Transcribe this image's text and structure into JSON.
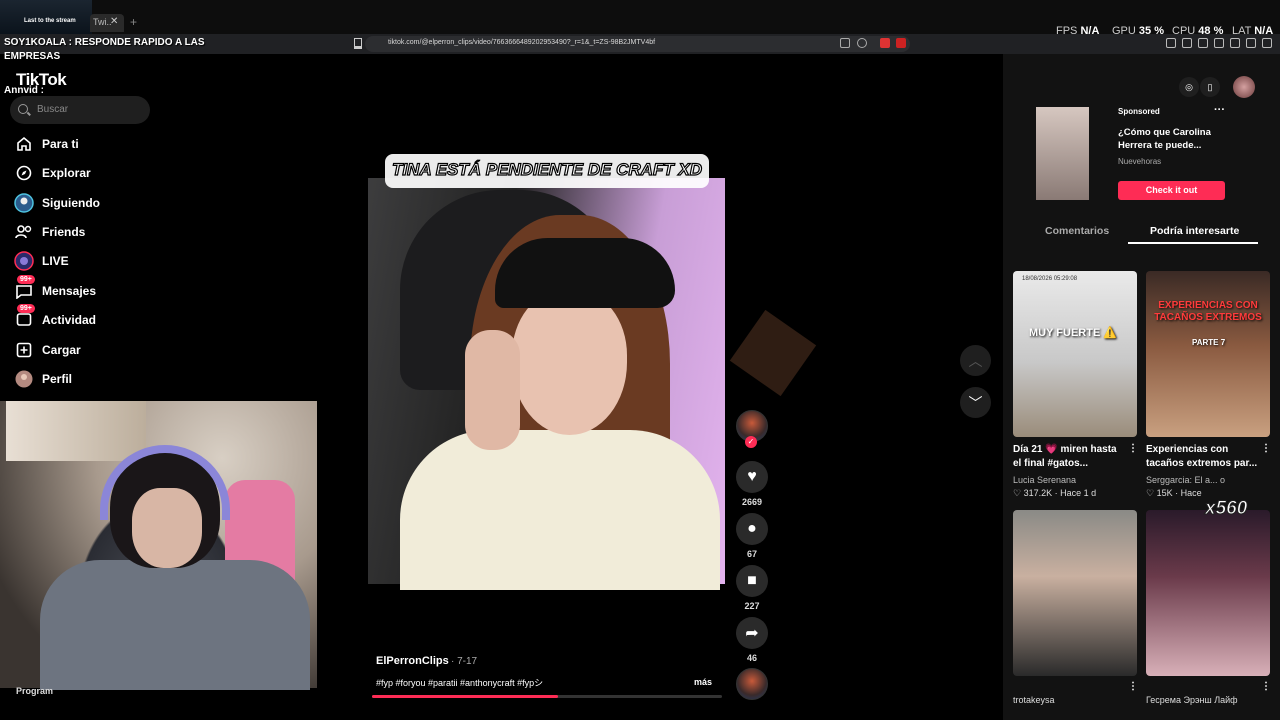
{
  "browser": {
    "tab_label": "Twi..",
    "url": "tiktok.com/@elperron_clips/video/7663666489202953490?_r=1&_t=ZS-98B2JMTV4bf",
    "perf": [
      {
        "key": "FPS",
        "value": "N/A"
      },
      {
        "key": "GPU",
        "value": "35 %"
      },
      {
        "key": "CPU",
        "value": "48 %"
      },
      {
        "key": "LAT",
        "value": "N/A"
      }
    ]
  },
  "stream": {
    "overlay_text": "Last to the stream",
    "chat_1": "SOY1KOALA : RESPONDE RAPIDO A LAS",
    "chat_1b": "EMPRESAS",
    "chat_2": "Annvid :",
    "program_label": "Program"
  },
  "sidebar": {
    "logo": "TikTok",
    "search_placeholder": "Buscar",
    "items": [
      {
        "label": "Para ti",
        "icon": "home-icon"
      },
      {
        "label": "Explorar",
        "icon": "compass-icon"
      },
      {
        "label": "Siguiendo",
        "icon": "following-icon"
      },
      {
        "label": "Friends",
        "icon": "friends-icon"
      },
      {
        "label": "LIVE",
        "icon": "live-icon"
      },
      {
        "label": "Mensajes",
        "icon": "messages-icon",
        "badge": "99+"
      },
      {
        "label": "Actividad",
        "icon": "activity-icon",
        "badge": "99+"
      },
      {
        "label": "Cargar",
        "icon": "upload-icon"
      },
      {
        "label": "Perfil",
        "icon": "profile-avatar"
      }
    ]
  },
  "video": {
    "caption": "TINA ESTÁ PENDIENTE DE CRAFT XD",
    "author": "ElPerronClips",
    "date": "· 7-17",
    "hashtags": "#fyp #foryou #paratii #anthonycraft #fypシ",
    "more": "más",
    "progress": 0.53,
    "likes": "2669",
    "comments": "67",
    "saves": "227",
    "shares": "46"
  },
  "ad": {
    "sponsored": "Sponsored",
    "title": "¿Cómo que Carolina Herrera te puede...",
    "brand": "Nuevehoras",
    "cta": "Check it out",
    "more": "···"
  },
  "panel_tabs": [
    "Comentarios",
    "Podría interesarte"
  ],
  "cards": [
    {
      "overlay": "MUY FUERTE ⚠️",
      "timestamp": "18/08/2026  05:29:08",
      "title": "Día 21 💗 miren hasta el final #gatos...",
      "author": "Lucia Serenana",
      "likes": "♡ 317.2K",
      "when": "Hace 1 d"
    },
    {
      "overlay": "EXPERIENCIAS CON TACAÑOS EXTREMOS",
      "overlay_sub": "PARTE 7",
      "title": "Experiencias con tacaños extremos par...",
      "author": "Serggarcia: El a... o",
      "likes": "♡ 15K",
      "when": "Hace"
    },
    {
      "author": "trotakeysa"
    },
    {
      "author": "Гесрема Эрэнш Лайф"
    }
  ],
  "x_badge": "x560"
}
